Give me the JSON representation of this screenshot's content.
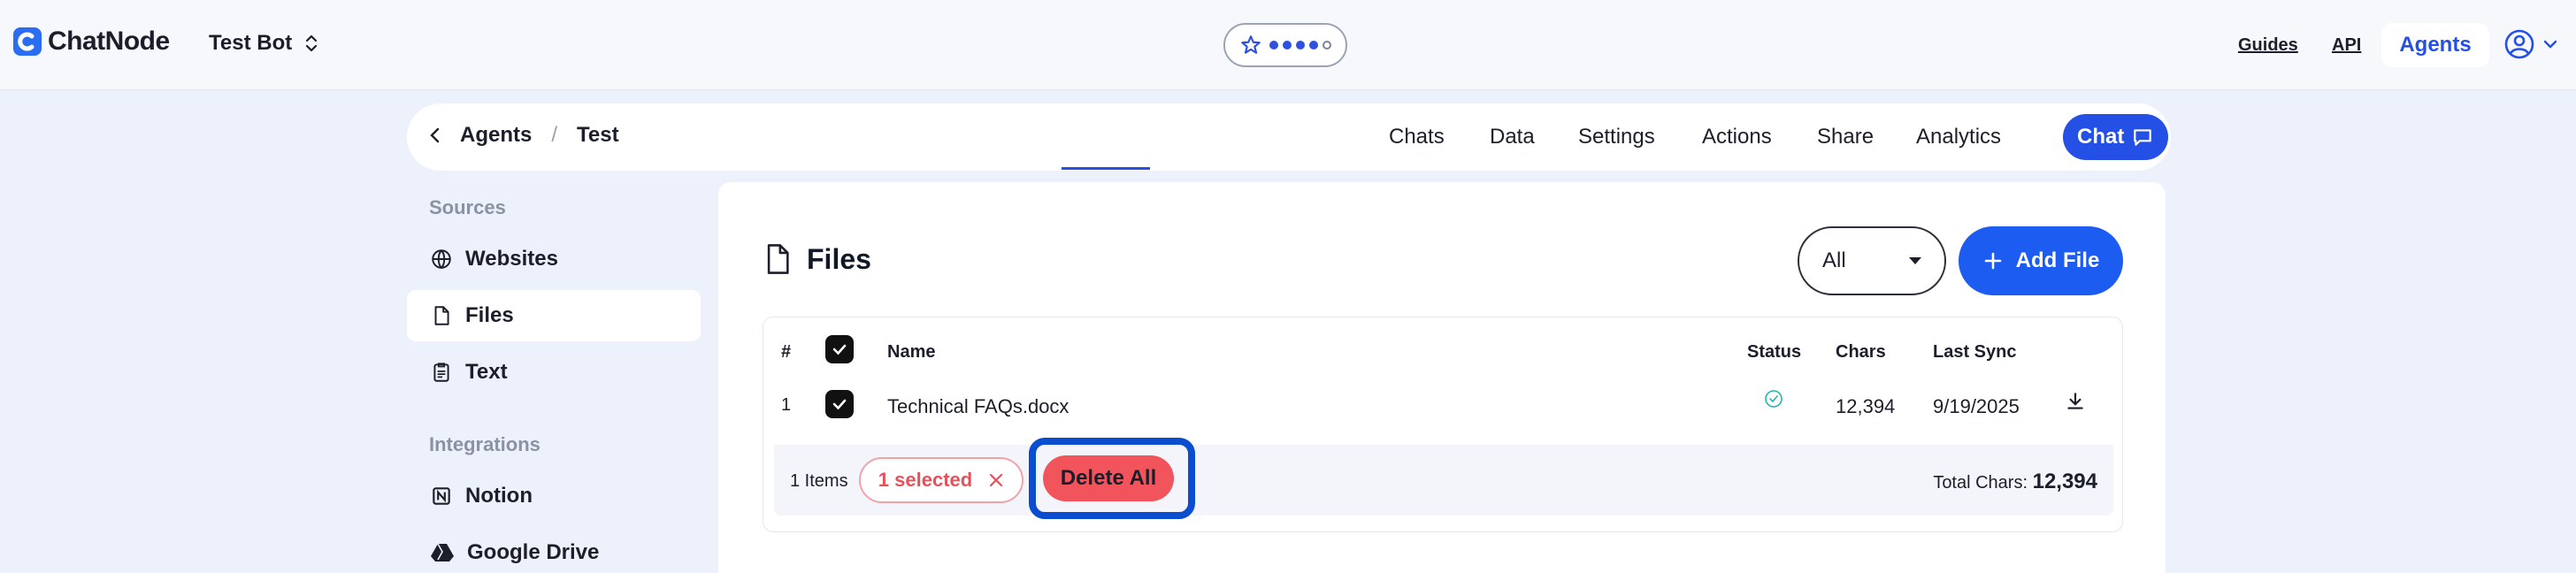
{
  "header": {
    "brand": "ChatNode",
    "bot_name": "Test Bot",
    "rating": {
      "filled": 4,
      "total": 5
    },
    "links": {
      "guides": "Guides",
      "api": "API",
      "agents": "Agents"
    }
  },
  "subnav": {
    "breadcrumb": {
      "parent": "Agents",
      "separator": "/",
      "current": "Test"
    },
    "tabs": [
      {
        "label": "Chats"
      },
      {
        "label": "Data"
      },
      {
        "label": "Settings"
      },
      {
        "label": "Actions"
      },
      {
        "label": "Share"
      },
      {
        "label": "Analytics"
      }
    ],
    "active_tab": "Data",
    "chat_button": "Chat"
  },
  "sidebar": {
    "sources_heading": "Sources",
    "sources": [
      {
        "label": "Websites",
        "icon": "globe-icon"
      },
      {
        "label": "Files",
        "icon": "file-icon"
      },
      {
        "label": "Text",
        "icon": "clipboard-icon"
      }
    ],
    "active_item": "Files",
    "integrations_heading": "Integrations",
    "integrations": [
      {
        "label": "Notion",
        "icon": "notion-icon"
      },
      {
        "label": "Google Drive",
        "icon": "google-drive-icon"
      }
    ]
  },
  "main": {
    "title": "Files",
    "filter_value": "All",
    "add_button": "Add File",
    "table": {
      "headers": {
        "index": "#",
        "name": "Name",
        "status": "Status",
        "chars": "Chars",
        "last_sync": "Last Sync"
      },
      "rows": [
        {
          "index": "1",
          "name": "Technical FAQs.docx",
          "status": "synced",
          "chars": "12,394",
          "last_sync": "9/19/2025"
        }
      ]
    },
    "footer": {
      "items_count": "1 Items",
      "selected": "1 selected",
      "delete_all": "Delete All",
      "total_label": "Total Chars:",
      "total_value": "12,394"
    }
  },
  "colors": {
    "accent": "#2450e6",
    "danger": "#f2545b",
    "highlight_outline": "#0a4ecf",
    "status_ok": "#22b8a8"
  }
}
